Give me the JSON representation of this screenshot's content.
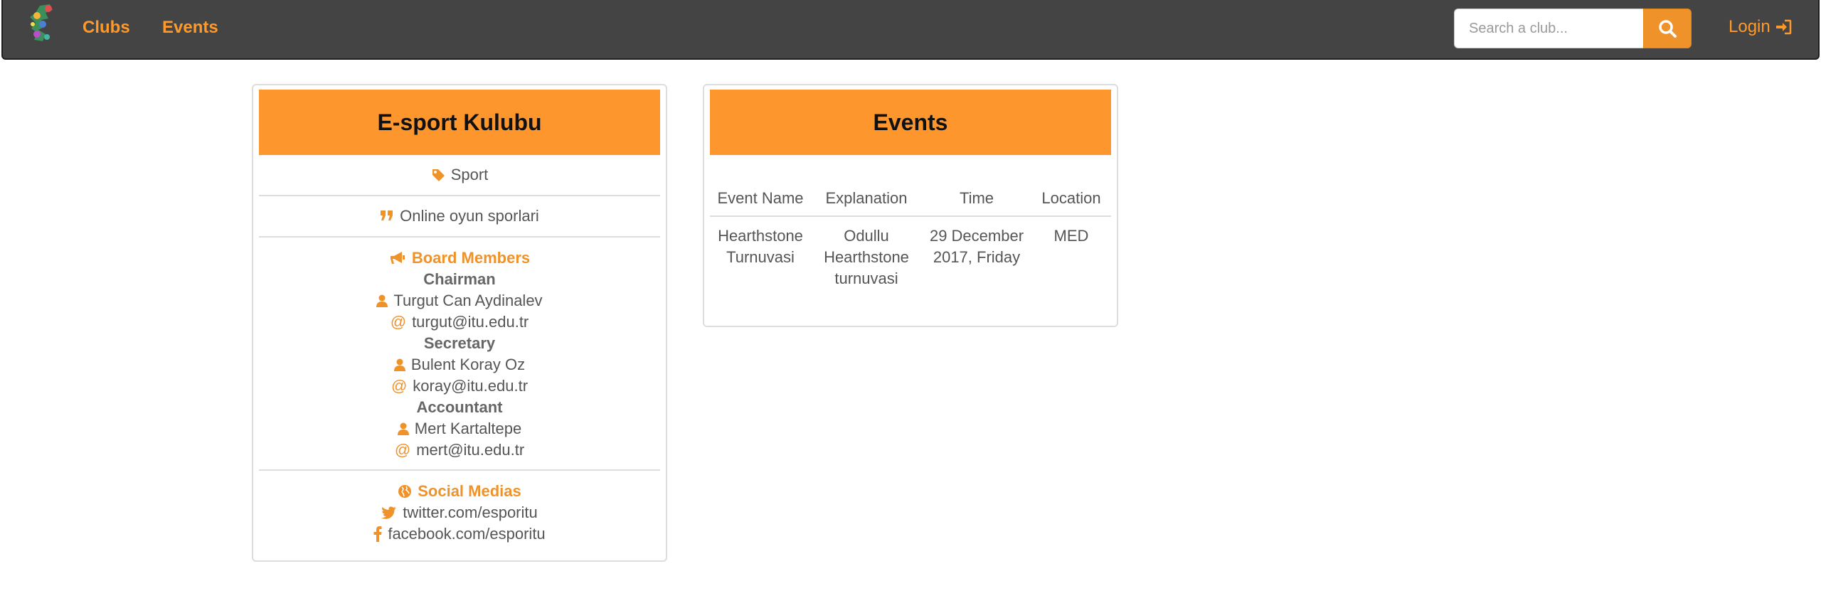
{
  "navbar": {
    "links": {
      "clubs": "Clubs",
      "events": "Events"
    },
    "search_placeholder": "Search a club...",
    "search_icon": "search-icon",
    "login_label": "Login",
    "login_icon": "sign-in-icon"
  },
  "club": {
    "title": "E-sport Kulubu",
    "category": "Sport",
    "description": "Online oyun sporlari",
    "board_title": "Board Members",
    "members": [
      {
        "role": "Chairman",
        "name": "Turgut Can Aydinalev",
        "email": "turgut@itu.edu.tr"
      },
      {
        "role": "Secretary",
        "name": "Bulent Koray Oz",
        "email": "koray@itu.edu.tr"
      },
      {
        "role": "Accountant",
        "name": "Mert Kartaltepe",
        "email": "mert@itu.edu.tr"
      }
    ],
    "social_title": "Social Medias",
    "social": {
      "twitter": "twitter.com/esporitu",
      "facebook": "facebook.com/esporitu"
    }
  },
  "events": {
    "title": "Events",
    "columns": [
      "Event Name",
      "Explanation",
      "Time",
      "Location"
    ],
    "rows": [
      {
        "name": "Hearthstone Turnuvasi",
        "explanation": "Odullu Hearthstone turnuvasi",
        "time": "29 December 2017, Friday",
        "location": "MED"
      }
    ]
  },
  "colors": {
    "accent": "#f0922a",
    "navbar": "#444444",
    "heading": "#fd962d"
  }
}
